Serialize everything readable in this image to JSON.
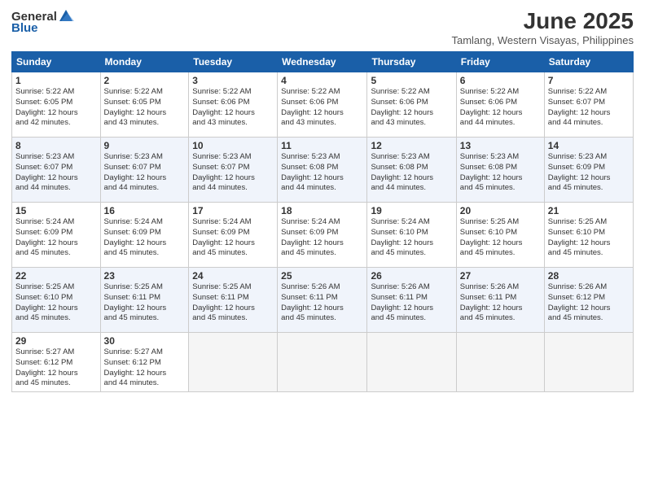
{
  "header": {
    "logo_general": "General",
    "logo_blue": "Blue",
    "title": "June 2025",
    "subtitle": "Tamlang, Western Visayas, Philippines"
  },
  "columns": [
    "Sunday",
    "Monday",
    "Tuesday",
    "Wednesday",
    "Thursday",
    "Friday",
    "Saturday"
  ],
  "weeks": [
    [
      {
        "day": "1",
        "info": "Sunrise: 5:22 AM\nSunset: 6:05 PM\nDaylight: 12 hours\nand 42 minutes."
      },
      {
        "day": "2",
        "info": "Sunrise: 5:22 AM\nSunset: 6:05 PM\nDaylight: 12 hours\nand 43 minutes."
      },
      {
        "day": "3",
        "info": "Sunrise: 5:22 AM\nSunset: 6:06 PM\nDaylight: 12 hours\nand 43 minutes."
      },
      {
        "day": "4",
        "info": "Sunrise: 5:22 AM\nSunset: 6:06 PM\nDaylight: 12 hours\nand 43 minutes."
      },
      {
        "day": "5",
        "info": "Sunrise: 5:22 AM\nSunset: 6:06 PM\nDaylight: 12 hours\nand 43 minutes."
      },
      {
        "day": "6",
        "info": "Sunrise: 5:22 AM\nSunset: 6:06 PM\nDaylight: 12 hours\nand 44 minutes."
      },
      {
        "day": "7",
        "info": "Sunrise: 5:22 AM\nSunset: 6:07 PM\nDaylight: 12 hours\nand 44 minutes."
      }
    ],
    [
      {
        "day": "8",
        "info": "Sunrise: 5:23 AM\nSunset: 6:07 PM\nDaylight: 12 hours\nand 44 minutes."
      },
      {
        "day": "9",
        "info": "Sunrise: 5:23 AM\nSunset: 6:07 PM\nDaylight: 12 hours\nand 44 minutes."
      },
      {
        "day": "10",
        "info": "Sunrise: 5:23 AM\nSunset: 6:07 PM\nDaylight: 12 hours\nand 44 minutes."
      },
      {
        "day": "11",
        "info": "Sunrise: 5:23 AM\nSunset: 6:08 PM\nDaylight: 12 hours\nand 44 minutes."
      },
      {
        "day": "12",
        "info": "Sunrise: 5:23 AM\nSunset: 6:08 PM\nDaylight: 12 hours\nand 44 minutes."
      },
      {
        "day": "13",
        "info": "Sunrise: 5:23 AM\nSunset: 6:08 PM\nDaylight: 12 hours\nand 45 minutes."
      },
      {
        "day": "14",
        "info": "Sunrise: 5:23 AM\nSunset: 6:09 PM\nDaylight: 12 hours\nand 45 minutes."
      }
    ],
    [
      {
        "day": "15",
        "info": "Sunrise: 5:24 AM\nSunset: 6:09 PM\nDaylight: 12 hours\nand 45 minutes."
      },
      {
        "day": "16",
        "info": "Sunrise: 5:24 AM\nSunset: 6:09 PM\nDaylight: 12 hours\nand 45 minutes."
      },
      {
        "day": "17",
        "info": "Sunrise: 5:24 AM\nSunset: 6:09 PM\nDaylight: 12 hours\nand 45 minutes."
      },
      {
        "day": "18",
        "info": "Sunrise: 5:24 AM\nSunset: 6:09 PM\nDaylight: 12 hours\nand 45 minutes."
      },
      {
        "day": "19",
        "info": "Sunrise: 5:24 AM\nSunset: 6:10 PM\nDaylight: 12 hours\nand 45 minutes."
      },
      {
        "day": "20",
        "info": "Sunrise: 5:25 AM\nSunset: 6:10 PM\nDaylight: 12 hours\nand 45 minutes."
      },
      {
        "day": "21",
        "info": "Sunrise: 5:25 AM\nSunset: 6:10 PM\nDaylight: 12 hours\nand 45 minutes."
      }
    ],
    [
      {
        "day": "22",
        "info": "Sunrise: 5:25 AM\nSunset: 6:10 PM\nDaylight: 12 hours\nand 45 minutes."
      },
      {
        "day": "23",
        "info": "Sunrise: 5:25 AM\nSunset: 6:11 PM\nDaylight: 12 hours\nand 45 minutes."
      },
      {
        "day": "24",
        "info": "Sunrise: 5:25 AM\nSunset: 6:11 PM\nDaylight: 12 hours\nand 45 minutes."
      },
      {
        "day": "25",
        "info": "Sunrise: 5:26 AM\nSunset: 6:11 PM\nDaylight: 12 hours\nand 45 minutes."
      },
      {
        "day": "26",
        "info": "Sunrise: 5:26 AM\nSunset: 6:11 PM\nDaylight: 12 hours\nand 45 minutes."
      },
      {
        "day": "27",
        "info": "Sunrise: 5:26 AM\nSunset: 6:11 PM\nDaylight: 12 hours\nand 45 minutes."
      },
      {
        "day": "28",
        "info": "Sunrise: 5:26 AM\nSunset: 6:12 PM\nDaylight: 12 hours\nand 45 minutes."
      }
    ],
    [
      {
        "day": "29",
        "info": "Sunrise: 5:27 AM\nSunset: 6:12 PM\nDaylight: 12 hours\nand 45 minutes."
      },
      {
        "day": "30",
        "info": "Sunrise: 5:27 AM\nSunset: 6:12 PM\nDaylight: 12 hours\nand 44 minutes."
      },
      {
        "day": "",
        "info": ""
      },
      {
        "day": "",
        "info": ""
      },
      {
        "day": "",
        "info": ""
      },
      {
        "day": "",
        "info": ""
      },
      {
        "day": "",
        "info": ""
      }
    ]
  ]
}
